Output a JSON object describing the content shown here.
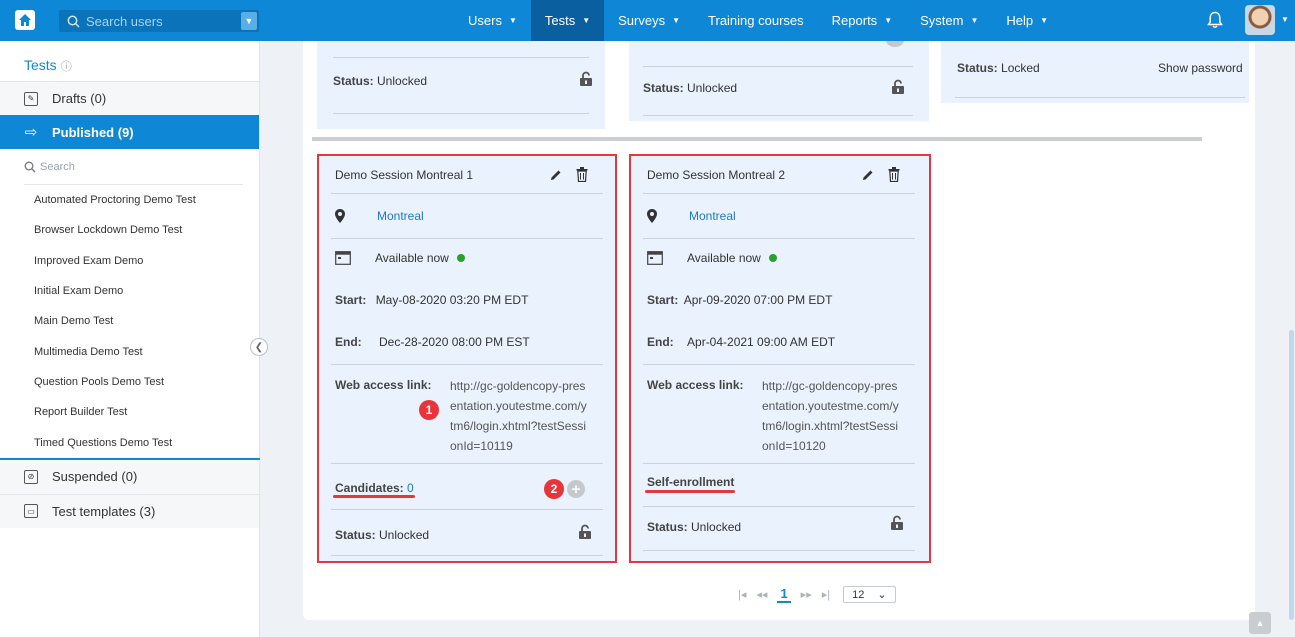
{
  "topbar": {
    "search_placeholder": "Search users",
    "nav": [
      {
        "label": "Users",
        "dropdown": true,
        "active": false
      },
      {
        "label": "Tests",
        "dropdown": true,
        "active": true
      },
      {
        "label": "Surveys",
        "dropdown": true,
        "active": false
      },
      {
        "label": "Training courses",
        "dropdown": false,
        "active": false
      },
      {
        "label": "Reports",
        "dropdown": true,
        "active": false
      },
      {
        "label": "System",
        "dropdown": true,
        "active": false
      },
      {
        "label": "Help",
        "dropdown": true,
        "active": false
      }
    ],
    "brand_color": "#0e87d6"
  },
  "sidebar": {
    "title": "Tests",
    "drafts": "Drafts (0)",
    "published": "Published (9)",
    "search_placeholder": "Search",
    "tests": [
      "Automated Proctoring Demo Test",
      "Browser Lockdown Demo Test",
      "Improved Exam Demo",
      "Initial Exam Demo",
      "Main Demo Test",
      "Multimedia Demo Test",
      "Question Pools Demo Test",
      "Report Builder Test",
      "Timed Questions Demo Test"
    ],
    "suspended": "Suspended (0)",
    "templates": "Test templates (3)"
  },
  "top_cards": {
    "left_status_label": "Status:",
    "left_status_value": "Unlocked",
    "middle_status_label": "Status:",
    "middle_status_value": "Unlocked",
    "right_status_label": "Status:",
    "right_status_value": "Locked",
    "right_show_password": "Show password"
  },
  "sessions": [
    {
      "name": "Demo Session Montreal 1",
      "location": "Montreal",
      "availability": "Available now",
      "start_label": "Start:",
      "start": "May-08-2020 03:20 PM EDT",
      "end_label": "End:",
      "end": "Dec-28-2020 08:00 PM EST",
      "link_label": "Web access link:",
      "link_lines": [
        "http://gc-goldencopy-pres",
        "entation.youtestme.com/y",
        "tm6/login.xhtml?testSessi",
        "onId=10119"
      ],
      "enroll_label": "Candidates:",
      "enroll_value": "0",
      "status_label": "Status:",
      "status": "Unlocked"
    },
    {
      "name": "Demo Session Montreal 2",
      "location": "Montreal",
      "availability": "Available now",
      "start_label": "Start:",
      "start": "Apr-09-2020 07:00 PM EDT",
      "end_label": "End:",
      "end": "Apr-04-2021 09:00 AM EDT",
      "link_label": "Web access link:",
      "link_lines": [
        "http://gc-goldencopy-pres",
        "entation.youtestme.com/y",
        "tm6/login.xhtml?testSessi",
        "onId=10120"
      ],
      "enroll_label": "Self-enrollment",
      "status_label": "Status:",
      "status": "Unlocked"
    }
  ],
  "badges": {
    "one": "1",
    "two": "2"
  },
  "pager": {
    "first": "|◂",
    "prev": "◂◂",
    "current": "1",
    "next": "▸▸",
    "last": "▸|",
    "page_size": "12"
  }
}
